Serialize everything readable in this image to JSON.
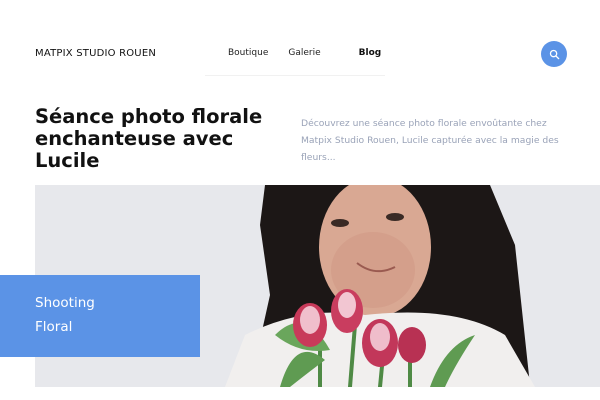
{
  "brand": "MATPIX STUDIO ROUEN",
  "nav": {
    "items": [
      "Boutique",
      "Galerie",
      "Blog"
    ],
    "active": "Blog"
  },
  "search": {
    "icon": "search-icon"
  },
  "post": {
    "title": "Séance photo florale enchanteuse avec Lucile",
    "intro": "Découvrez une séance photo florale envoûtante chez Matpix Studio Rouen, Lucile capturée avec la magie des fleurs..."
  },
  "badge": {
    "line1": "Shooting",
    "line2": "Floral"
  },
  "colors": {
    "accent": "#5b93e6",
    "muted_text": "#9aa3b8",
    "text": "#111111"
  },
  "image": {
    "subject": "portrait-with-tulips"
  }
}
